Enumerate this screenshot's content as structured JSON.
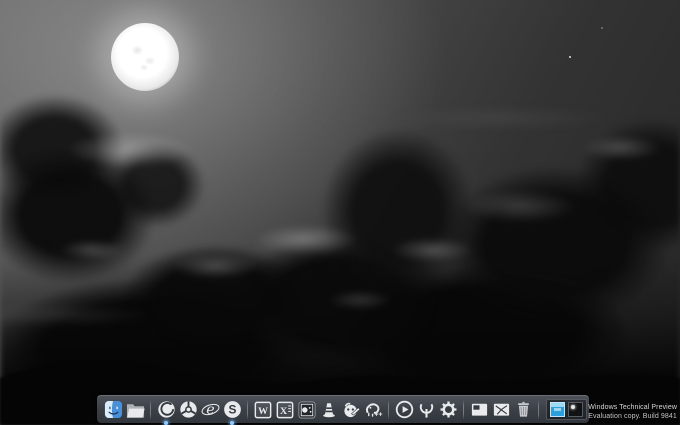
{
  "wallpaper": {
    "name": "moonlit-night-clouds"
  },
  "watermark": {
    "line1": "Windows Technical Preview",
    "line2": "Evaluation copy. Build 9841"
  },
  "colors": {
    "accent_blue": "#2aa0dd",
    "running_indicator": "#8ec9ff",
    "dock_background": "#3d4249",
    "icon_monochrome": "#e8eaec",
    "watermark_text": "#d6d6d6"
  },
  "dock": {
    "items": [
      {
        "id": "finder",
        "label": "Finder"
      },
      {
        "id": "file-explorer",
        "label": "File Explorer"
      },
      {
        "id": "separator"
      },
      {
        "id": "firefox",
        "label": "Firefox",
        "running": true
      },
      {
        "id": "chrome",
        "label": "Chrome"
      },
      {
        "id": "internet-explorer",
        "label": "Internet Explorer"
      },
      {
        "id": "skype",
        "label": "Skype",
        "running": true
      },
      {
        "id": "separator"
      },
      {
        "id": "word",
        "label": "Word"
      },
      {
        "id": "excel",
        "label": "Excel"
      },
      {
        "id": "photo-viewer",
        "label": "Photo Viewer"
      },
      {
        "id": "vlc",
        "label": "VLC Media Player"
      },
      {
        "id": "gimp",
        "label": "GIMP"
      },
      {
        "id": "notepad-plus-plus",
        "label": "Notepad++"
      },
      {
        "id": "separator"
      },
      {
        "id": "media-player",
        "label": "Media Player"
      },
      {
        "id": "quake",
        "label": "Quake"
      },
      {
        "id": "settings",
        "label": "Settings"
      },
      {
        "id": "separator"
      },
      {
        "id": "app-window",
        "label": "App Window"
      },
      {
        "id": "app-window-cracked",
        "label": "App Window (cracked)"
      },
      {
        "id": "recycle-bin",
        "label": "Recycle Bin"
      },
      {
        "id": "separator"
      },
      {
        "id": "window-previews",
        "label": "Open Windows"
      }
    ]
  },
  "taskband": {
    "window_previews": [
      {
        "state": "active"
      },
      {
        "state": "inactive"
      }
    ]
  }
}
